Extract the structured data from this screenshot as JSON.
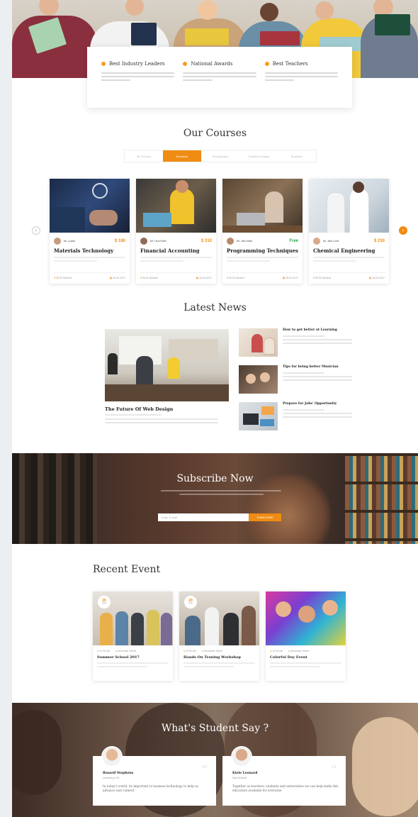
{
  "features": [
    {
      "title": "Best Industry Leaders"
    },
    {
      "title": "National Awards"
    },
    {
      "title": "Best Teachers"
    }
  ],
  "courses": {
    "title": "Our Courses",
    "filters": [
      "All Courses",
      "Business",
      "Photography",
      "Graphics Design",
      "Business"
    ],
    "active_filter": 1,
    "cards": [
      {
        "title": "Materials Technology",
        "instructor": "Mr. Louise",
        "price": "$ 180",
        "students": "50,00 Student",
        "date": "25-04-2017"
      },
      {
        "title": "Financial Accounting",
        "instructor": "Mr. Tina Robin",
        "price": "$ 310",
        "students": "50,00 Student",
        "date": "25-04-2017"
      },
      {
        "title": "Programming Techniques",
        "instructor": "Mr. John Wick",
        "price": "Free",
        "students": "50,00 Student",
        "date": "25-04-2017"
      },
      {
        "title": "Chemical Engineering",
        "instructor": "Mr. Jane Croft",
        "price": "$ 230",
        "students": "50,00 Student",
        "date": "25-04-2017"
      }
    ]
  },
  "news": {
    "title": "Latest News",
    "main_title": "The Future Of Web Design",
    "side": [
      {
        "title": "How to get better at Learning"
      },
      {
        "title": "Tips for being better Musician"
      },
      {
        "title": "Prepare for Jobs' Opportunity"
      }
    ]
  },
  "subscribe": {
    "title": "Subscribe Now",
    "placeholder": "Enter E-mail",
    "button": "SUBSCRIBE"
  },
  "events": {
    "title": "Recent Event",
    "items": [
      {
        "day": "25",
        "month": "April",
        "name": "Summer School 2017",
        "time": "10:30 AM",
        "place": "Alexander Street"
      },
      {
        "day": "20",
        "month": "April",
        "name": "Hands On Traning Workshop",
        "time": "10:30 AM",
        "place": "Alexander Street"
      },
      {
        "day": "",
        "month": "",
        "name": "Colorful Day Event",
        "time": "10:30 AM",
        "place": "Alexander Street"
      }
    ]
  },
  "testimonials": {
    "title": "What's Student Say ?",
    "items": [
      {
        "name": "Russell Stephens",
        "role": "University of UK",
        "text": "In today's world, its important to harness technology to help us advance and connect"
      },
      {
        "name": "Kiele Leonard",
        "role": "Data Scientist",
        "text": "Together as teachers, students and universities we can help make this education available for everyone"
      }
    ]
  },
  "colors": {
    "accent": "#f08c14",
    "free": "#2fa84f"
  }
}
